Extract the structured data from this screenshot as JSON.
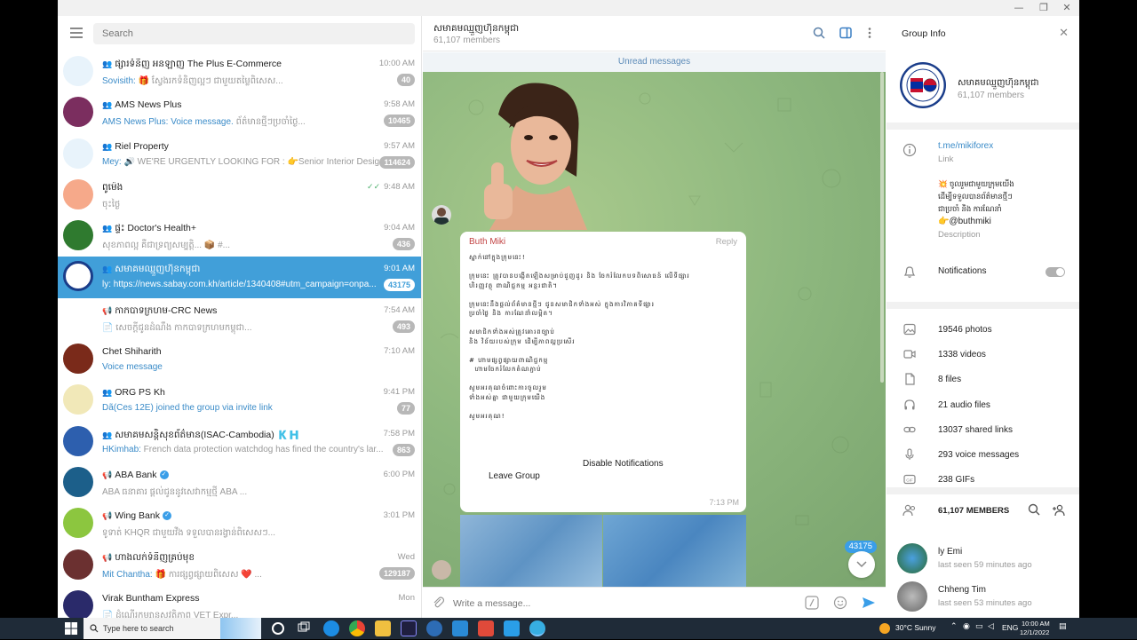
{
  "window": {
    "minimize": "—",
    "maximize": "❐",
    "close": "✕"
  },
  "sidebar": {
    "search_placeholder": "Search",
    "chats": [
      {
        "name": "ផ្សារទំនិញ អនឡាញ The Plus E-Commerce",
        "time": "10:00 AM",
        "sender": "Sovisith:",
        "preview": " 🎁 ស្វែងរកទំនិញល្អៗ ជាមួយតម្លៃពិសេស...",
        "badge": "40",
        "kind": "group"
      },
      {
        "name": "AMS News Plus",
        "time": "9:58 AM",
        "sender": "AMS News Plus: Voice message.",
        "preview": " ព័ត៌មានថ្មីៗប្រចាំថ្ងៃ...",
        "badge": "10465",
        "kind": "group"
      },
      {
        "name": "Riel Property",
        "time": "9:57 AM",
        "sender": "Mey:",
        "preview": " 🔊 WE'RE URGENTLY LOOKING FOR : 👉Senior Interior Desig...",
        "badge": "114624",
        "kind": "group"
      },
      {
        "name": "ពូម៉េង",
        "time": "9:48 AM",
        "sender": "",
        "preview": "ចុះថ្ងៃ",
        "badge": "",
        "kind": "user",
        "read": "✓✓"
      },
      {
        "name": "ផ្ទះ Doctor's Health+",
        "time": "9:04 AM",
        "sender": "",
        "preview": "សុខភាពល្អ គឺជាទ្រព្យសម្បត្តិ... 📦 #...",
        "badge": "436",
        "kind": "group"
      },
      {
        "name": "សមាគមឈ្មួញហ៊ុនកម្ពុជា",
        "time": "9:01 AM",
        "sender": "",
        "preview": "ly: https://news.sabay.com.kh/article/1340408#utm_campaign=onpa...",
        "badge": "43175",
        "kind": "group"
      },
      {
        "name": "កាកបាទក្រហម-CRC News",
        "time": "7:54 AM",
        "sender": "",
        "preview": "📄 សេចក្តីជូនដំណឹង កាកបាទក្រហមកម្ពុជា...",
        "badge": "493",
        "kind": "channel"
      },
      {
        "name": "Chet Shiharith",
        "time": "7:10 AM",
        "sender": "Voice message",
        "preview": "",
        "badge": "",
        "kind": "user"
      },
      {
        "name": "ORG PS Kh",
        "time": "9:41 PM",
        "sender": "Dã(Ces 12E) joined the group via invite link",
        "preview": "",
        "badge": "77",
        "kind": "group"
      },
      {
        "name": "សមាគមសន្តិសុខព័ត៌មាន(ISAC-Cambodia) 🇰🇭",
        "time": "7:58 PM",
        "sender": "HKimhab:",
        "preview": " French data protection watchdog has fined the country's lar...",
        "badge": "863",
        "kind": "group"
      },
      {
        "name": "ABA Bank",
        "time": "6:00 PM",
        "sender": "",
        "preview": "ABA ធនាគារ ផ្តល់ជូននូវសេវាកម្មថ្មី ABA ...",
        "badge": "",
        "kind": "channel",
        "verified": true
      },
      {
        "name": "Wing Bank",
        "time": "3:01 PM",
        "sender": "",
        "preview": "ទូទាត់ KHQR ជាមួយវីង ទទួលបានរង្វាន់ពិសេសៗ...",
        "badge": "",
        "kind": "channel",
        "verified": true
      },
      {
        "name": "ហាងលក់ទំនិញគ្រប់មុខ",
        "time": "Wed",
        "sender": "Mit Chantha:",
        "preview": " 🎁 ការផ្សព្វផ្សាយពិសេស ❤️ ...",
        "badge": "129187",
        "kind": "channel"
      },
      {
        "name": "Virak Buntham Express",
        "time": "Mon",
        "sender": "",
        "preview": "📄 ដំណើរកម្សាន្តសុវត្ថិភាព VET Expr...",
        "badge": "",
        "kind": "user"
      }
    ]
  },
  "chat": {
    "title": "សមាគមឈ្មួញហ៊ុនកម្ពុជា",
    "members": "61,107 members",
    "unread_label": "Unread messages",
    "message": {
      "author": "Buth Miki",
      "reply": "Reply",
      "text": "ស្នាក់នៅក្នុងក្រុមនេះ!\n\nក្រុមនេះ ត្រូវបានបង្កើតឡើងសម្រាប់ជួញដូរ និង ចែករំលែកបទពិសោធន៍ លើទីផ្សារ\nហិរញ្ញវត្ថុ ពាណិជ្ជកម្ម អន្តរជាតិ។\n\nក្រុមនេះនឹងផ្តល់ព័ត៌មានថ្មីៗ ជូនសមាជិកទាំងអស់ ក្នុងការវិភាគទីផ្សារ\nប្រចាំថ្ងៃ និង ការណែនាំលម្អិត។\n\nសមាជិកទាំងអស់ត្រូវគោរពច្បាប់\nនិង វិន័យរបស់ក្រុម ដើម្បីភាពល្អប្រសើរ\n\n# ហាមផ្សព្វផ្សាយពាណិជ្ជកម្ម\n  ហាមចែករំលែកតំណភ្ជាប់\n\nសូមអរគុណចំពោះការចូលរួម\nទាំងអស់គ្នា ជាមួយក្រុមយើង\n\nសូមអរគុណ!",
      "overlay_1": "Disable Notifications",
      "overlay_2": "Leave Group",
      "time": "7:13 PM"
    },
    "unread_count": "43175",
    "composer_placeholder": "Write a message..."
  },
  "info": {
    "title": "Group Info",
    "group_name": "សមាគមឈ្មួញហ៊ុនកម្ពុជា",
    "members": "61,107 members",
    "link": "t.me/mikiforex",
    "link_label": "Link",
    "description_l1": "💥 ចូលរួមជាមួយក្រុមយើង",
    "description_l2": "ដើម្បីទទួលបានព័ត៌មានថ្មីៗ",
    "description_l3": "ជាប្រចាំ និង ការណែនាំ",
    "description_handle": "👉@buthmiki",
    "description_label": "Description",
    "notifications": "Notifications",
    "media": [
      {
        "icon": "photo",
        "label": "19546 photos"
      },
      {
        "icon": "video",
        "label": "1338 videos"
      },
      {
        "icon": "file",
        "label": "8 files"
      },
      {
        "icon": "audio",
        "label": "21 audio files"
      },
      {
        "icon": "link",
        "label": "13037 shared links"
      },
      {
        "icon": "mic",
        "label": "293 voice messages"
      },
      {
        "icon": "gif",
        "label": "238 GIFs"
      }
    ],
    "members_header": "61,107 MEMBERS",
    "member_list": [
      {
        "name": "ly Emi",
        "seen": "last seen 59 minutes ago"
      },
      {
        "name": "Chheng Tim",
        "seen": "last seen 53 minutes ago"
      }
    ]
  },
  "taskbar": {
    "search": "Type here to search",
    "weather": "30°C  Sunny",
    "lang": "ENG",
    "time": "10:00 AM",
    "date": "12/1/2022"
  }
}
